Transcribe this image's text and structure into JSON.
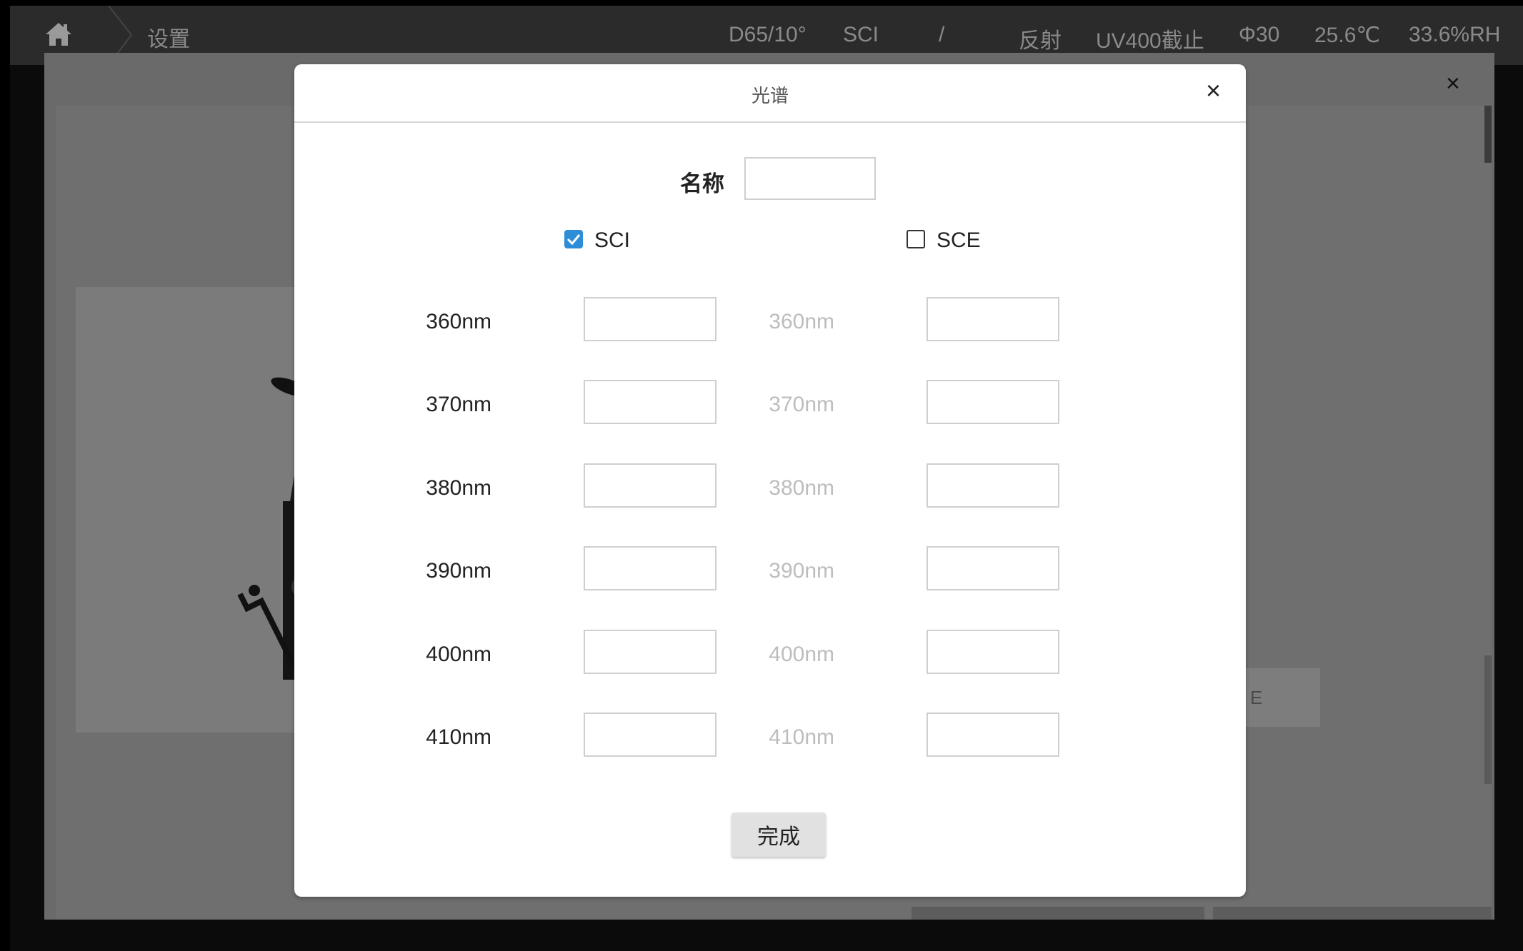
{
  "topbar": {
    "title": "设置",
    "status": [
      "D65/10°",
      "SCI",
      "/",
      "反射",
      "UV400截止",
      "Φ30",
      "25.6℃",
      "33.6%RH"
    ]
  },
  "background": {
    "button_fragment": "E",
    "close_glyph": "×"
  },
  "dialog": {
    "title": "光谱",
    "close_glyph": "×",
    "name_label": "名称",
    "name_value": "",
    "sci": {
      "label": "SCI",
      "checked": true
    },
    "sce": {
      "label": "SCE",
      "checked": false
    },
    "rows": [
      {
        "label": "360nm",
        "sci_value": "",
        "sce_value": ""
      },
      {
        "label": "370nm",
        "sci_value": "",
        "sce_value": ""
      },
      {
        "label": "380nm",
        "sci_value": "",
        "sce_value": ""
      },
      {
        "label": "390nm",
        "sci_value": "",
        "sce_value": ""
      },
      {
        "label": "400nm",
        "sci_value": "",
        "sce_value": ""
      },
      {
        "label": "410nm",
        "sci_value": "",
        "sce_value": ""
      }
    ],
    "done_label": "完成"
  },
  "colors": {
    "accent": "#2d8dd6",
    "disabled_text": "#bdbdbd"
  }
}
